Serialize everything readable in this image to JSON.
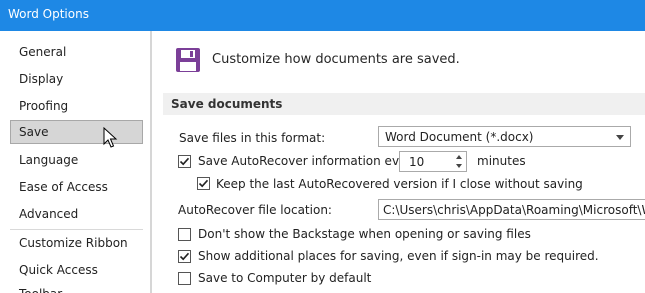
{
  "window": {
    "title": "Word Options"
  },
  "sidebar": {
    "items": [
      {
        "label": "General"
      },
      {
        "label": "Display"
      },
      {
        "label": "Proofing"
      },
      {
        "label": "Save",
        "selected": true
      },
      {
        "label": "Language"
      },
      {
        "label": "Ease of Access"
      },
      {
        "label": "Advanced"
      },
      {
        "label": "Customize Ribbon"
      },
      {
        "label": "Quick Access Toolbar"
      }
    ]
  },
  "header": {
    "text": "Customize how documents are saved.",
    "icon": "floppy-disk-icon",
    "icon_color": "#7b3f98"
  },
  "section": {
    "title": "Save documents"
  },
  "options": {
    "format_label": "Save files in this format:",
    "format_value": "Word Document (*.docx)",
    "autorecover_label": "Save AutoRecover information every",
    "autorecover_checked": true,
    "autorecover_minutes": "10",
    "minutes_label": "minutes",
    "keep_last_label": "Keep the last AutoRecovered version if I close without saving",
    "keep_last_checked": true,
    "location_label": "AutoRecover file location:",
    "location_value": "C:\\Users\\chris\\AppData\\Roaming\\Microsoft\\Word\\",
    "backstage_label": "Don't show the Backstage when opening or saving files",
    "backstage_checked": false,
    "additional_places_label": "Show additional places for saving, even if sign-in may be required.",
    "additional_places_checked": true,
    "computer_default_label": "Save to Computer by default",
    "computer_default_checked": false
  },
  "colors": {
    "titlebar": "#1e88e5",
    "selected_item": "#d6d6d6",
    "section_bar": "#f0f0f0"
  }
}
